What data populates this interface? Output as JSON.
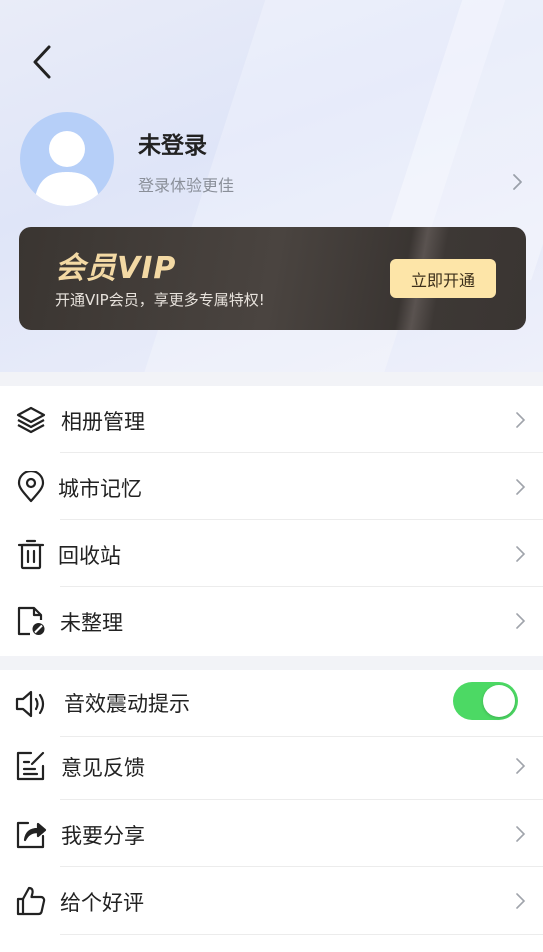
{
  "profile": {
    "name": "未登录",
    "subtitle": "登录体验更佳"
  },
  "vip": {
    "title": "会员VIP",
    "description": "开通VIP会员，享更多专属特权!",
    "button_label": "立即开通"
  },
  "section1": [
    {
      "label": "相册管理",
      "icon": "layers-icon"
    },
    {
      "label": "城市记忆",
      "icon": "location-pin-icon"
    },
    {
      "label": "回收站",
      "icon": "trash-icon"
    },
    {
      "label": "未整理",
      "icon": "file-blocked-icon"
    }
  ],
  "section2": [
    {
      "label": "音效震动提示",
      "icon": "speaker-icon",
      "toggle_on": true
    },
    {
      "label": "意见反馈",
      "icon": "edit-note-icon"
    },
    {
      "label": "我要分享",
      "icon": "share-icon"
    },
    {
      "label": "给个好评",
      "icon": "thumbs-up-icon"
    }
  ],
  "colors": {
    "toggle_on": "#4cd964",
    "vip_accent": "#f3d9a4",
    "vip_button": "#fde5a8"
  }
}
